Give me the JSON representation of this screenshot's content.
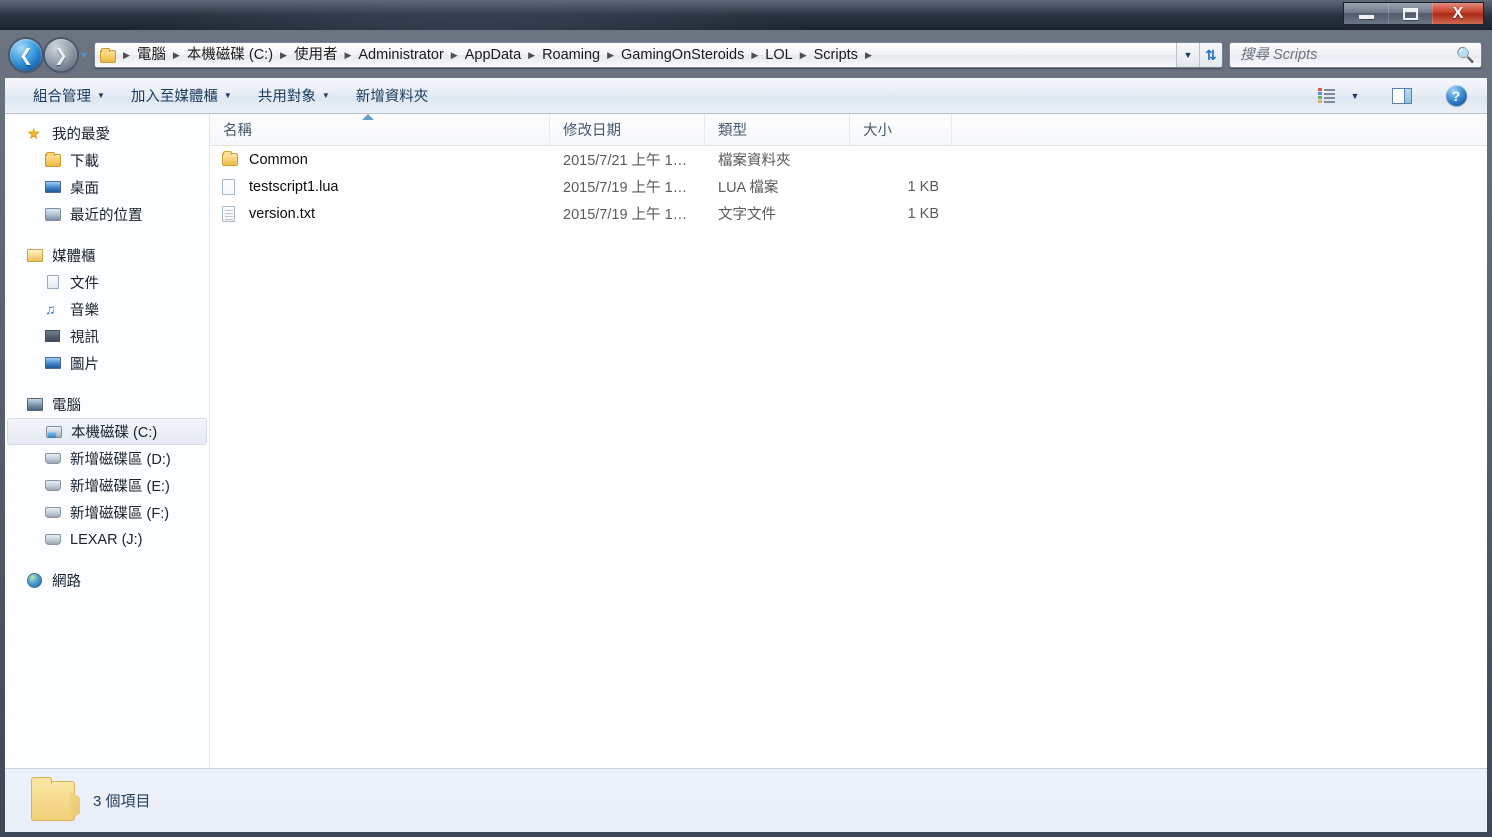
{
  "window": {
    "controls": {
      "minimize_label": "最小化",
      "maximize_label": "最大化",
      "close_label": "X"
    }
  },
  "nav": {
    "back_label": "◄",
    "forward_label": "►",
    "history_label": "▼",
    "address_icon": "folder-icon",
    "breadcrumbs": [
      "電腦",
      "本機磁碟 (C:)",
      "使用者",
      "Administrator",
      "AppData",
      "Roaming",
      "GamingOnSteroids",
      "LOL",
      "Scripts"
    ],
    "separator": "▶",
    "dropdown_label": "▼",
    "refresh_label": "↻"
  },
  "search": {
    "placeholder": "搜尋 Scripts",
    "value": "",
    "icon": "search-icon"
  },
  "toolbar": {
    "items": [
      {
        "label": "組合管理",
        "has_caret": true
      },
      {
        "label": "加入至媒體櫃",
        "has_caret": true
      },
      {
        "label": "共用對象",
        "has_caret": true
      },
      {
        "label": "新增資料夾",
        "has_caret": false
      }
    ],
    "view_caret": "▼",
    "help_label": "?"
  },
  "sidebar": {
    "groups": [
      {
        "header": {
          "label": "我的最愛",
          "icon": "star-icon"
        },
        "items": [
          {
            "label": "下載",
            "icon": "download-folder-icon"
          },
          {
            "label": "桌面",
            "icon": "desktop-icon"
          },
          {
            "label": "最近的位置",
            "icon": "recent-places-icon"
          }
        ]
      },
      {
        "header": {
          "label": "媒體櫃",
          "icon": "library-icon"
        },
        "items": [
          {
            "label": "文件",
            "icon": "documents-icon"
          },
          {
            "label": "音樂",
            "icon": "music-icon"
          },
          {
            "label": "視訊",
            "icon": "video-icon"
          },
          {
            "label": "圖片",
            "icon": "pictures-icon"
          }
        ]
      },
      {
        "header": {
          "label": "電腦",
          "icon": "computer-icon"
        },
        "items": [
          {
            "label": "本機磁碟 (C:)",
            "icon": "system-drive-icon",
            "selected": true
          },
          {
            "label": "新增磁碟區 (D:)",
            "icon": "drive-icon"
          },
          {
            "label": "新增磁碟區 (E:)",
            "icon": "drive-icon"
          },
          {
            "label": "新增磁碟區 (F:)",
            "icon": "drive-icon"
          },
          {
            "label": "LEXAR (J:)",
            "icon": "removable-drive-icon"
          }
        ]
      },
      {
        "header": {
          "label": "網路",
          "icon": "network-icon"
        },
        "items": []
      }
    ]
  },
  "filelist": {
    "columns": [
      {
        "key": "name",
        "label": "名稱",
        "sorted": true
      },
      {
        "key": "date",
        "label": "修改日期"
      },
      {
        "key": "type",
        "label": "類型"
      },
      {
        "key": "size",
        "label": "大小"
      }
    ],
    "rows": [
      {
        "name": "Common",
        "date": "2015/7/21 上午 1…",
        "type": "檔案資料夾",
        "size": "",
        "icon": "folder-icon"
      },
      {
        "name": "testscript1.lua",
        "date": "2015/7/19 上午 1…",
        "type": "LUA 檔案",
        "size": "1 KB",
        "icon": "file-icon"
      },
      {
        "name": "version.txt",
        "date": "2015/7/19 上午 1…",
        "type": "文字文件",
        "size": "1 KB",
        "icon": "text-file-icon"
      }
    ]
  },
  "statusbar": {
    "icon": "folder-icon",
    "text": "3 個項目"
  }
}
